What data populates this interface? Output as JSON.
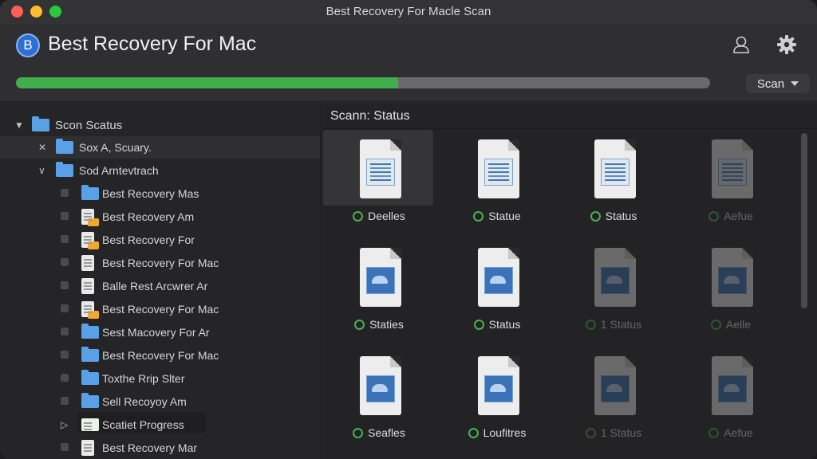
{
  "window": {
    "title": "Best Recovery For Macle Scan"
  },
  "header": {
    "logo_letter": "B",
    "app_name": "Best Recovery For Mac",
    "progress_fraction": 0.55,
    "scan_button_label": "Scan"
  },
  "colors": {
    "accent_green": "#3fae4b",
    "folder_blue": "#5aa0e6",
    "background": "#2b2b2d"
  },
  "sidebar": {
    "items": [
      {
        "label": "Scon Scatus",
        "disclosure": "▼",
        "icon": "folder-icon"
      },
      {
        "label": "Sox A, Scuary.",
        "disclosure": "✕",
        "icon": "folder-icon"
      },
      {
        "label": "Sod Arntevtrach",
        "disclosure": "∨",
        "icon": "folder-icon"
      },
      {
        "label": "Best Recovery Mas",
        "icon": "folder-icon"
      },
      {
        "label": "Best Recovery Am",
        "icon": "document-folder-icon"
      },
      {
        "label": "Best Recovery For",
        "icon": "document-folder-icon"
      },
      {
        "label": "Best Recovery For Mac",
        "icon": "document-icon"
      },
      {
        "label": "Balle Rest Arcwrer Ar",
        "icon": "document-icon"
      },
      {
        "label": "Best Recovery For Mac",
        "icon": "document-folder-icon"
      },
      {
        "label": "Sest Macovery For Ar",
        "icon": "folder-icon"
      },
      {
        "label": "Best Recovery For Mac",
        "icon": "folder-icon"
      },
      {
        "label": "Toxthe Rrip Slter",
        "icon": "folder-icon"
      },
      {
        "label": "Sell Recoyoy Am",
        "icon": "folder-icon"
      },
      {
        "label": "Scatiet Progress",
        "disclosure": "▷",
        "icon": "spreadsheet-icon"
      },
      {
        "label": "Best Recovery Mar",
        "icon": "document-icon"
      }
    ]
  },
  "main": {
    "title": "Scann: Status",
    "tiles": [
      {
        "label": "Deelles",
        "thumb": "doc"
      },
      {
        "label": "Statue",
        "thumb": "doc"
      },
      {
        "label": "Status",
        "thumb": "doc"
      },
      {
        "label": "Aefue",
        "thumb": "doc"
      },
      {
        "label": "Staties",
        "thumb": "img"
      },
      {
        "label": "Status",
        "thumb": "img"
      },
      {
        "label": "1 Status",
        "thumb": "img"
      },
      {
        "label": "Aelle",
        "thumb": "img"
      },
      {
        "label": "Seafles",
        "thumb": "img"
      },
      {
        "label": "Loufitres",
        "thumb": "img"
      },
      {
        "label": "1 Status",
        "thumb": "img"
      },
      {
        "label": "Aefue",
        "thumb": "img"
      }
    ]
  }
}
